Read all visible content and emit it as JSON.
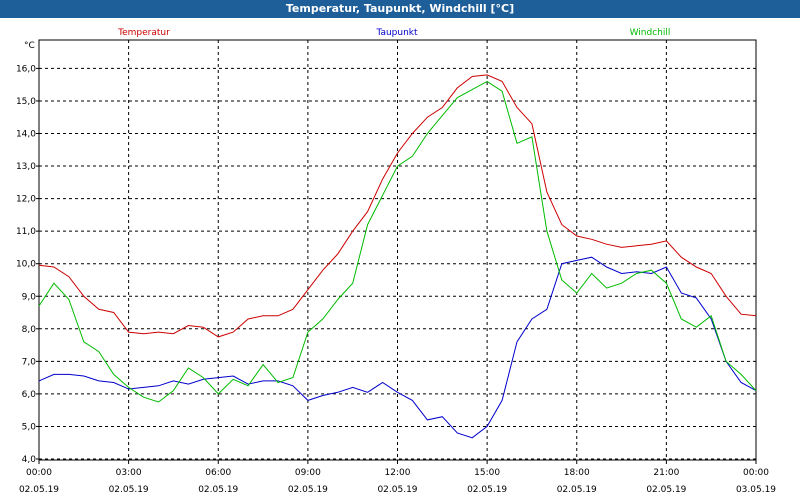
{
  "window": {
    "title": "Temperatur, Taupunkt, Windchill [°C]"
  },
  "chart_data": {
    "type": "line",
    "ylabel": "°C",
    "ylim": [
      4.0,
      16.5
    ],
    "yticks": [
      "4,0",
      "5,0",
      "6,0",
      "7,0",
      "8,0",
      "9,0",
      "10,0",
      "11,0",
      "12,0",
      "13,0",
      "14,0",
      "15,0",
      "16,0"
    ],
    "xlim": [
      0,
      24
    ],
    "xticks": [
      {
        "time": "00:00",
        "date": "02.05.19"
      },
      {
        "time": "03:00",
        "date": "02.05.19"
      },
      {
        "time": "06:00",
        "date": "02.05.19"
      },
      {
        "time": "09:00",
        "date": "02.05.19"
      },
      {
        "time": "12:00",
        "date": "02.05.19"
      },
      {
        "time": "15:00",
        "date": "02.05.19"
      },
      {
        "time": "18:00",
        "date": "02.05.19"
      },
      {
        "time": "21:00",
        "date": "02.05.19"
      },
      {
        "time": "00:00",
        "date": "03.05.19"
      }
    ],
    "grid": true,
    "series": [
      {
        "name": "Temperatur",
        "color": "#cc0000",
        "points": [
          [
            0,
            9.95
          ],
          [
            0.5,
            9.9
          ],
          [
            1,
            9.6
          ],
          [
            1.5,
            9.0
          ],
          [
            2,
            8.6
          ],
          [
            2.5,
            8.5
          ],
          [
            3,
            7.9
          ],
          [
            3.5,
            7.85
          ],
          [
            4,
            7.9
          ],
          [
            4.5,
            7.85
          ],
          [
            5,
            8.1
          ],
          [
            5.5,
            8.05
          ],
          [
            6,
            7.75
          ],
          [
            6.5,
            7.9
          ],
          [
            7,
            8.3
          ],
          [
            7.5,
            8.4
          ],
          [
            8,
            8.4
          ],
          [
            8.5,
            8.6
          ],
          [
            9,
            9.2
          ],
          [
            9.5,
            9.8
          ],
          [
            10,
            10.3
          ],
          [
            10.5,
            11.0
          ],
          [
            11,
            11.6
          ],
          [
            11.5,
            12.6
          ],
          [
            12,
            13.4
          ],
          [
            12.5,
            14.0
          ],
          [
            13,
            14.5
          ],
          [
            13.5,
            14.8
          ],
          [
            14,
            15.4
          ],
          [
            14.5,
            15.75
          ],
          [
            15,
            15.8
          ],
          [
            15.5,
            15.6
          ],
          [
            16,
            14.8
          ],
          [
            16.5,
            14.3
          ],
          [
            17,
            12.2
          ],
          [
            17.5,
            11.2
          ],
          [
            18,
            10.85
          ],
          [
            18.5,
            10.75
          ],
          [
            19,
            10.6
          ],
          [
            19.5,
            10.5
          ],
          [
            20,
            10.55
          ],
          [
            20.5,
            10.6
          ],
          [
            21,
            10.7
          ],
          [
            21.5,
            10.2
          ],
          [
            22,
            9.9
          ],
          [
            22.5,
            9.7
          ],
          [
            23,
            9.0
          ],
          [
            23.5,
            8.45
          ],
          [
            24,
            8.4
          ]
        ]
      },
      {
        "name": "Taupunkt",
        "color": "#0000cc",
        "points": [
          [
            0,
            6.4
          ],
          [
            0.5,
            6.6
          ],
          [
            1,
            6.6
          ],
          [
            1.5,
            6.55
          ],
          [
            2,
            6.4
          ],
          [
            2.5,
            6.35
          ],
          [
            3,
            6.15
          ],
          [
            3.5,
            6.2
          ],
          [
            4,
            6.25
          ],
          [
            4.5,
            6.4
          ],
          [
            5,
            6.3
          ],
          [
            5.5,
            6.45
          ],
          [
            6,
            6.5
          ],
          [
            6.5,
            6.55
          ],
          [
            7,
            6.3
          ],
          [
            7.5,
            6.4
          ],
          [
            8,
            6.4
          ],
          [
            8.5,
            6.25
          ],
          [
            9,
            5.8
          ],
          [
            9.5,
            5.95
          ],
          [
            10,
            6.05
          ],
          [
            10.5,
            6.2
          ],
          [
            11,
            6.05
          ],
          [
            11.5,
            6.35
          ],
          [
            12,
            6.05
          ],
          [
            12.5,
            5.8
          ],
          [
            13,
            5.2
          ],
          [
            13.5,
            5.3
          ],
          [
            14,
            4.8
          ],
          [
            14.5,
            4.65
          ],
          [
            15,
            5.0
          ],
          [
            15.5,
            5.8
          ],
          [
            16,
            7.6
          ],
          [
            16.5,
            8.3
          ],
          [
            17,
            8.6
          ],
          [
            17.5,
            10.0
          ],
          [
            18,
            10.1
          ],
          [
            18.5,
            10.2
          ],
          [
            19,
            9.9
          ],
          [
            19.5,
            9.7
          ],
          [
            20,
            9.75
          ],
          [
            20.5,
            9.7
          ],
          [
            21,
            9.9
          ],
          [
            21.5,
            9.1
          ],
          [
            22,
            8.95
          ],
          [
            22.5,
            8.3
          ],
          [
            23,
            7.0
          ],
          [
            23.5,
            6.35
          ],
          [
            24,
            6.1
          ]
        ]
      },
      {
        "name": "Windchill",
        "color": "#00bb00",
        "points": [
          [
            0,
            8.7
          ],
          [
            0.5,
            9.4
          ],
          [
            1,
            8.9
          ],
          [
            1.5,
            7.6
          ],
          [
            2,
            7.3
          ],
          [
            2.5,
            6.6
          ],
          [
            3,
            6.2
          ],
          [
            3.5,
            5.9
          ],
          [
            4,
            5.75
          ],
          [
            4.5,
            6.1
          ],
          [
            5,
            6.8
          ],
          [
            5.5,
            6.5
          ],
          [
            6,
            6.0
          ],
          [
            6.5,
            6.45
          ],
          [
            7,
            6.25
          ],
          [
            7.5,
            6.9
          ],
          [
            8,
            6.35
          ],
          [
            8.5,
            6.5
          ],
          [
            9,
            7.9
          ],
          [
            9.5,
            8.3
          ],
          [
            10,
            8.9
          ],
          [
            10.5,
            9.4
          ],
          [
            11,
            11.2
          ],
          [
            11.5,
            12.1
          ],
          [
            12,
            13.0
          ],
          [
            12.5,
            13.3
          ],
          [
            13,
            14.0
          ],
          [
            13.5,
            14.55
          ],
          [
            14,
            15.1
          ],
          [
            14.5,
            15.35
          ],
          [
            15,
            15.6
          ],
          [
            15.5,
            15.3
          ],
          [
            16,
            13.7
          ],
          [
            16.5,
            13.9
          ],
          [
            17,
            11.0
          ],
          [
            17.5,
            9.5
          ],
          [
            18,
            9.1
          ],
          [
            18.5,
            9.7
          ],
          [
            19,
            9.25
          ],
          [
            19.5,
            9.4
          ],
          [
            20,
            9.7
          ],
          [
            20.5,
            9.8
          ],
          [
            21,
            9.4
          ],
          [
            21.5,
            8.3
          ],
          [
            22,
            8.05
          ],
          [
            22.5,
            8.4
          ],
          [
            23,
            7.0
          ],
          [
            23.5,
            6.6
          ],
          [
            24,
            6.1
          ]
        ]
      }
    ]
  }
}
